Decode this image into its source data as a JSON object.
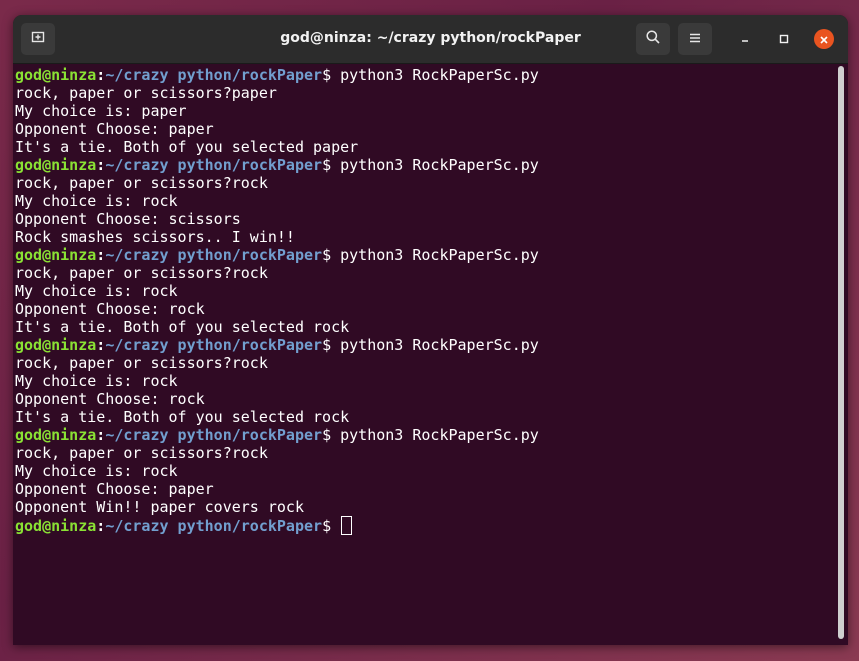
{
  "window": {
    "title": "god@ninza: ~/crazy python/rockPaper"
  },
  "icons": {
    "new_tab": "new-tab-icon",
    "search": "search-icon",
    "menu": "hamburger-menu-icon",
    "minimize": "minimize-icon",
    "maximize": "maximize-icon",
    "close": "close-icon"
  },
  "colors": {
    "terminal_bg": "#300a24",
    "prompt_user": "#8ae234",
    "prompt_path": "#729fcf",
    "close_button": "#e95420"
  },
  "prompt": {
    "user_host": "god@ninza",
    "separator": ":",
    "path": "~/crazy python/rockPaper",
    "symbol": "$ "
  },
  "terminal": {
    "lines": [
      {
        "type": "prompt",
        "command": "python3 RockPaperSc.py"
      },
      {
        "type": "text",
        "text": "rock, paper or scissors?paper"
      },
      {
        "type": "text",
        "text": "My choice is: paper"
      },
      {
        "type": "text",
        "text": "Opponent Choose: paper"
      },
      {
        "type": "text",
        "text": "It's a tie. Both of you selected paper"
      },
      {
        "type": "prompt",
        "command": "python3 RockPaperSc.py"
      },
      {
        "type": "text",
        "text": "rock, paper or scissors?rock"
      },
      {
        "type": "text",
        "text": "My choice is: rock"
      },
      {
        "type": "text",
        "text": "Opponent Choose: scissors"
      },
      {
        "type": "text",
        "text": "Rock smashes scissors.. I win!!"
      },
      {
        "type": "prompt",
        "command": "python3 RockPaperSc.py"
      },
      {
        "type": "text",
        "text": "rock, paper or scissors?rock"
      },
      {
        "type": "text",
        "text": "My choice is: rock"
      },
      {
        "type": "text",
        "text": "Opponent Choose: rock"
      },
      {
        "type": "text",
        "text": "It's a tie. Both of you selected rock"
      },
      {
        "type": "prompt",
        "command": "python3 RockPaperSc.py"
      },
      {
        "type": "text",
        "text": "rock, paper or scissors?rock"
      },
      {
        "type": "text",
        "text": "My choice is: rock"
      },
      {
        "type": "text",
        "text": "Opponent Choose: rock"
      },
      {
        "type": "text",
        "text": "It's a tie. Both of you selected rock"
      },
      {
        "type": "prompt",
        "command": "python3 RockPaperSc.py"
      },
      {
        "type": "text",
        "text": "rock, paper or scissors?rock"
      },
      {
        "type": "text",
        "text": "My choice is: rock"
      },
      {
        "type": "text",
        "text": "Opponent Choose: paper"
      },
      {
        "type": "text",
        "text": "Opponent Win!! paper covers rock"
      },
      {
        "type": "prompt",
        "command": "",
        "cursor": true
      }
    ]
  }
}
